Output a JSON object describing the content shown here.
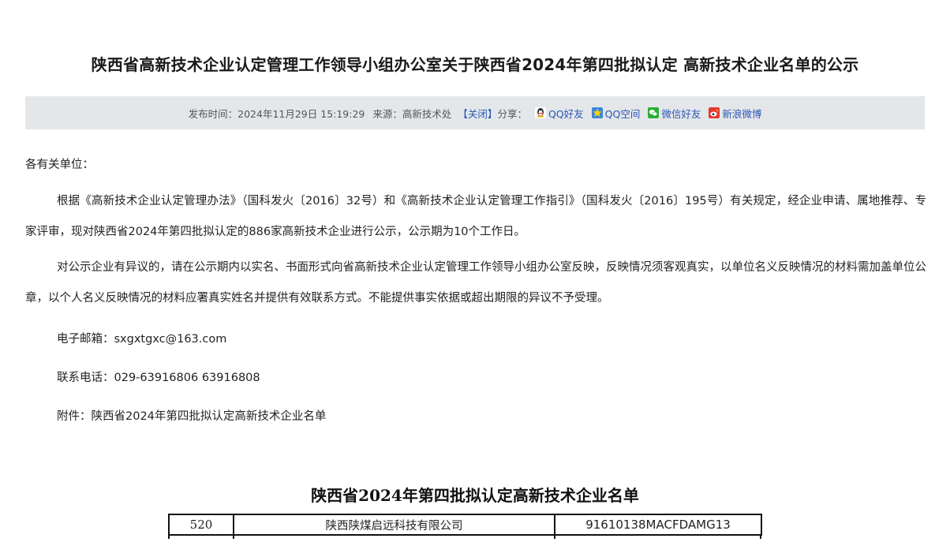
{
  "title": "陕西省高新技术企业认定管理工作领导小组办公室关于陕西省2024年第四批拟认定 高新技术企业名单的公示",
  "meta": {
    "publish_label": "发布时间：",
    "publish_time": "2024年11月29日 15:19:29",
    "source_label": "来源：",
    "source": "高新技术处",
    "close_label": "【关闭】",
    "share_label": "分享：",
    "share": [
      {
        "label": "QQ好友",
        "icon": "qq-icon"
      },
      {
        "label": "QQ空间",
        "icon": "qzone-icon"
      },
      {
        "label": "微信好友",
        "icon": "wechat-icon"
      },
      {
        "label": "新浪微博",
        "icon": "weibo-icon"
      }
    ]
  },
  "body": {
    "greeting": "各有关单位：",
    "paragraph1": "根据《高新技术企业认定管理办法》（国科发火〔2016〕32号）和《高新技术企业认定管理工作指引》（国科发火〔2016〕195号）有关规定，经企业申请、属地推荐、专家评审，现对陕西省2024年第四批拟认定的886家高新技术企业进行公示，公示期为10个工作日。",
    "paragraph2": "对公示企业有异议的，请在公示期内以实名、书面形式向省高新技术企业认定管理工作领导小组办公室反映，反映情况须客观真实，以单位名义反映情况的材料需加盖单位公章，以个人名义反映情况的材料应署真实姓名并提供有效联系方式。不能提供事实依据或超出期限的异议不予受理。",
    "email": "电子邮箱：sxgxtgxc@163.com",
    "phone": "联系电话：029-63916806  63916808",
    "attachment_label": "附件：",
    "attachment": "陕西省2024年第四批拟认定高新技术企业名单"
  },
  "document": {
    "title": "陕西省2024年第四批拟认定高新技术企业名单",
    "rows": [
      {
        "num": "520",
        "name": "陕西陕煤启远科技有限公司",
        "code": "91610138MACFDAMG13"
      }
    ]
  },
  "colors": {
    "meta_bg": "#e4e7ea",
    "link": "#2a56b5"
  }
}
